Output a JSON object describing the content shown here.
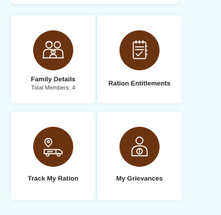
{
  "tiles": [
    {
      "label": "Family Details",
      "subtitle": "Total Members: 4",
      "icon": "family-icon"
    },
    {
      "label": "Ration Entitlements",
      "icon": "checklist-icon"
    },
    {
      "label": "Track My Ration",
      "icon": "delivery-truck-icon"
    },
    {
      "label": "My Grievances",
      "icon": "grievance-person-icon"
    }
  ],
  "colors": {
    "icon_circle": "#6b3410",
    "icon_line": "#ffffff",
    "background": "#f0fbfd",
    "card": "#ffffff"
  }
}
